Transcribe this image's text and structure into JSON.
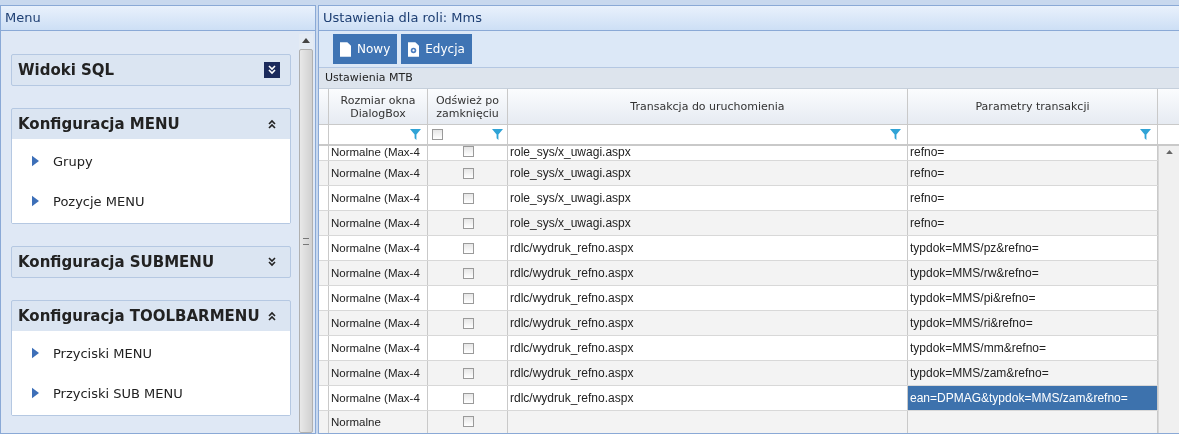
{
  "menu_panel": {
    "title": "Menu",
    "sections": [
      {
        "title": "Widoki SQL",
        "expanded": false,
        "focused": true
      },
      {
        "title": "Konfiguracja MENU",
        "expanded": true,
        "focused": false,
        "items": [
          "Grupy",
          "Pozycje MENU"
        ]
      },
      {
        "title": "Konfiguracja SUBMENU",
        "expanded": false,
        "focused": false
      },
      {
        "title": "Konfiguracja TOOLBARMENU",
        "expanded": true,
        "focused": false,
        "items": [
          "Przyciski MENU",
          "Przyciski SUB MENU"
        ]
      }
    ]
  },
  "settings_panel": {
    "title": "Ustawienia dla roli: Mms",
    "toolbar": [
      {
        "label": "Nowy",
        "kind": "new"
      },
      {
        "label": "Edycja",
        "kind": "edit"
      }
    ],
    "grid": {
      "caption": "Ustawienia MTB",
      "refresh_filter_checked": false,
      "columns": [
        "Rozmiar okna DialogBox",
        "Odśwież po zamknięciu",
        "Transakcja do uruchomienia",
        "Parametry transakcji"
      ],
      "rows": [
        {
          "size": "Normalne (Max-4",
          "refresh": false,
          "transaction": "role_sys/x_uwagi.aspx",
          "params": "refno=",
          "selected": false
        },
        {
          "size": "Normalne (Max-4",
          "refresh": false,
          "transaction": "role_sys/x_uwagi.aspx",
          "params": "refno=",
          "selected": false
        },
        {
          "size": "Normalne (Max-4",
          "refresh": false,
          "transaction": "role_sys/x_uwagi.aspx",
          "params": "refno=",
          "selected": false
        },
        {
          "size": "Normalne (Max-4",
          "refresh": false,
          "transaction": "role_sys/x_uwagi.aspx",
          "params": "refno=",
          "selected": false
        },
        {
          "size": "Normalne (Max-4",
          "refresh": false,
          "transaction": "rdlc/wydruk_refno.aspx",
          "params": "typdok=MMS/pz&refno=",
          "selected": false
        },
        {
          "size": "Normalne (Max-4",
          "refresh": false,
          "transaction": "rdlc/wydruk_refno.aspx",
          "params": "typdok=MMS/rw&refno=",
          "selected": false
        },
        {
          "size": "Normalne (Max-4",
          "refresh": false,
          "transaction": "rdlc/wydruk_refno.aspx",
          "params": "typdok=MMS/pi&refno=",
          "selected": false
        },
        {
          "size": "Normalne (Max-4",
          "refresh": false,
          "transaction": "rdlc/wydruk_refno.aspx",
          "params": "typdok=MMS/ri&refno=",
          "selected": false
        },
        {
          "size": "Normalne (Max-4",
          "refresh": false,
          "transaction": "rdlc/wydruk_refno.aspx",
          "params": "typdok=MMS/mm&refno=",
          "selected": false
        },
        {
          "size": "Normalne (Max-4",
          "refresh": false,
          "transaction": "rdlc/wydruk_refno.aspx",
          "params": "typdok=MMS/zam&refno=",
          "selected": false
        },
        {
          "size": "Normalne (Max-4",
          "refresh": false,
          "transaction": "rdlc/wydruk_refno.aspx",
          "params": "ean=DPMAG&typdok=MMS/zam&refno=",
          "selected": true
        },
        {
          "size": "Normalne",
          "refresh": false,
          "selected": false
        }
      ]
    }
  }
}
